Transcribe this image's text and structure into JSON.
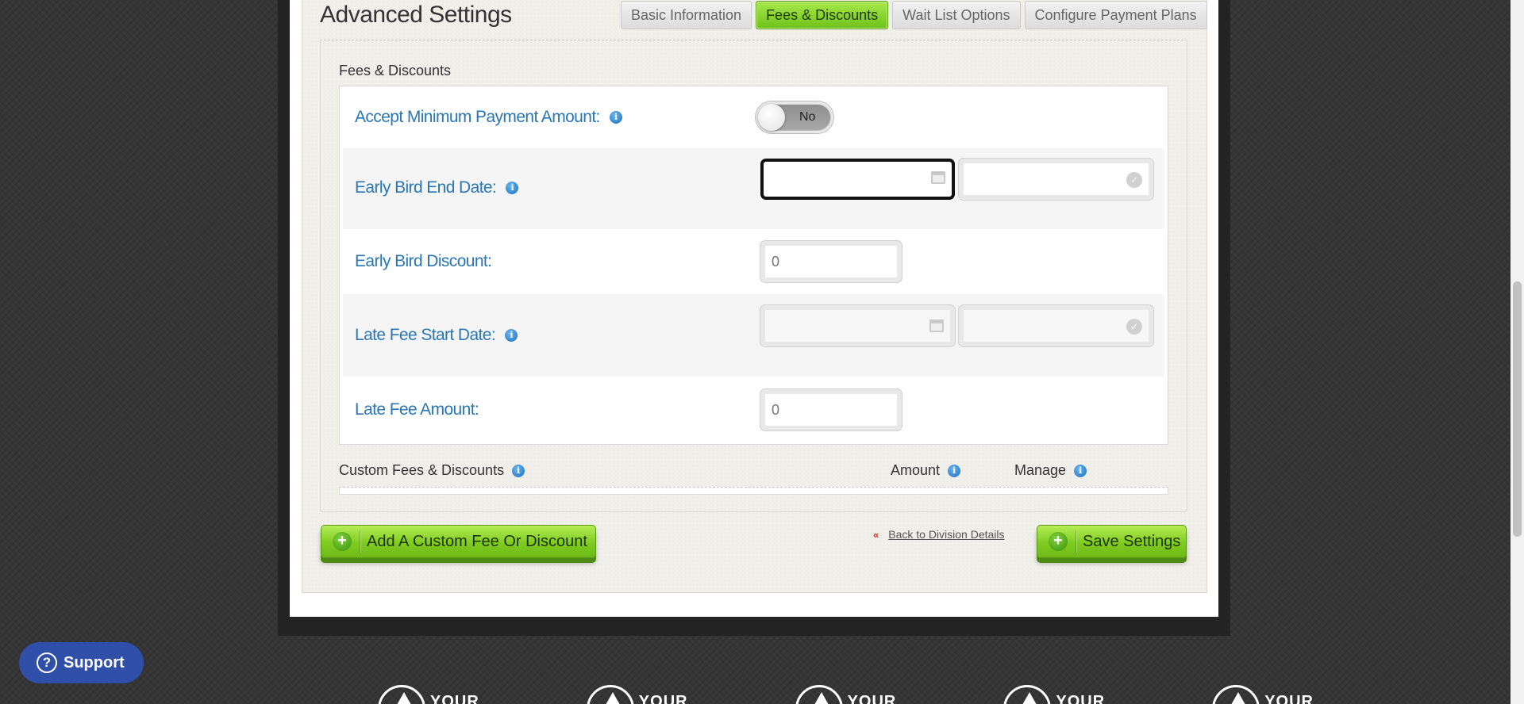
{
  "header": {
    "title": "Advanced Settings",
    "tabs": [
      {
        "label": "Basic Information",
        "active": false
      },
      {
        "label": "Fees & Discounts",
        "active": true
      },
      {
        "label": "Wait List Options",
        "active": false
      },
      {
        "label": "Configure Payment Plans",
        "active": false
      }
    ]
  },
  "section": {
    "title": "Fees & Discounts"
  },
  "form": {
    "min_payment": {
      "label": "Accept Minimum Payment Amount:",
      "toggle_text": "No"
    },
    "early_bird_end": {
      "label": "Early Bird End Date:",
      "date_value": "",
      "time_value": ""
    },
    "early_bird_discount": {
      "label": "Early Bird Discount:",
      "placeholder": "0"
    },
    "late_fee_start": {
      "label": "Late Fee Start Date:",
      "date_value": "",
      "time_value": ""
    },
    "late_fee_amount": {
      "label": "Late Fee Amount:",
      "placeholder": "0"
    }
  },
  "custom_fees": {
    "col_name": "Custom Fees & Discounts",
    "col_amount": "Amount",
    "col_manage": "Manage"
  },
  "actions": {
    "add_custom": "Add A Custom Fee Or Discount",
    "back_link": "Back to Division Details",
    "save": "Save Settings"
  },
  "support": {
    "label": "Support"
  },
  "footer": {
    "logo_word": "YOUR"
  },
  "colors": {
    "accent_green": "#7fcc20",
    "label_blue": "#2a76b3",
    "support_blue": "#2f4fa8"
  },
  "icons": [
    "info-icon",
    "calendar-icon",
    "clock-icon",
    "plus-circle-icon",
    "double-chevron-left-icon",
    "question-icon"
  ]
}
